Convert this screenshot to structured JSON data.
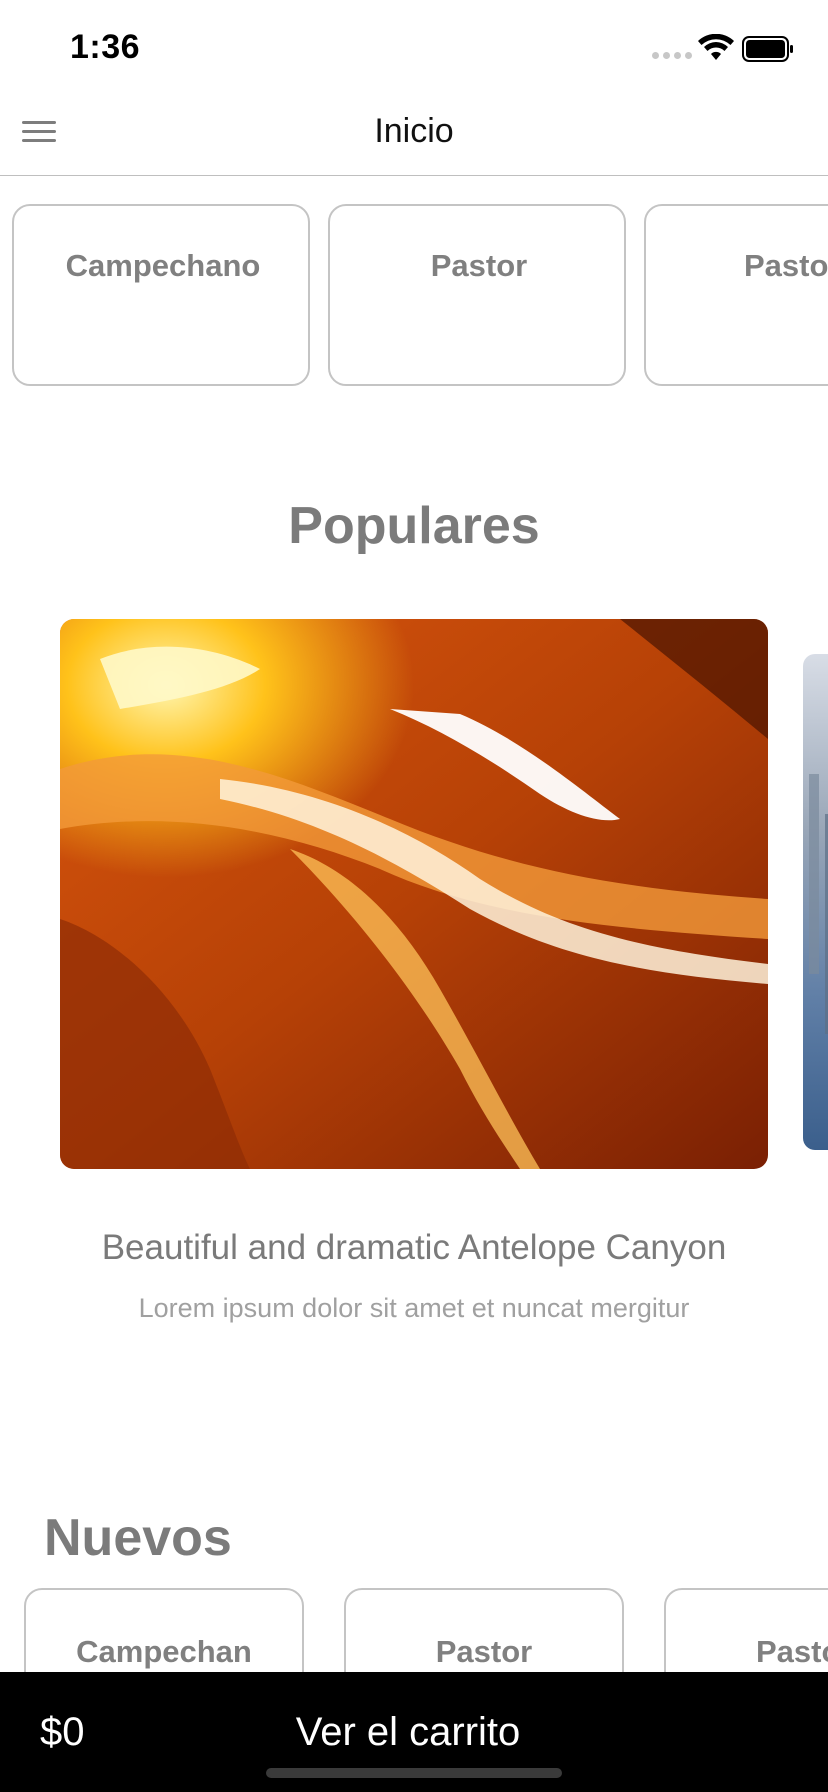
{
  "status_bar": {
    "time": "1:36"
  },
  "nav": {
    "title": "Inicio",
    "menu_icon": "hamburger-menu-icon"
  },
  "categories": [
    "Campechano",
    "Pastor",
    "Pasto"
  ],
  "popular": {
    "title": "Populares",
    "caption": "Beautiful and dramatic Antelope Canyon",
    "subtitle": "Lorem ipsum dolor sit amet et nuncat mergitur"
  },
  "new_section": {
    "title": "Nuevos",
    "items": [
      "Campechan",
      "Pastor",
      "Pasto"
    ]
  },
  "cart": {
    "total": "$0",
    "label": "Ver el carrito"
  },
  "colors": {
    "cart_bar": "#000000",
    "muted_text": "#7b7b7b",
    "border": "#c4c4c4"
  }
}
